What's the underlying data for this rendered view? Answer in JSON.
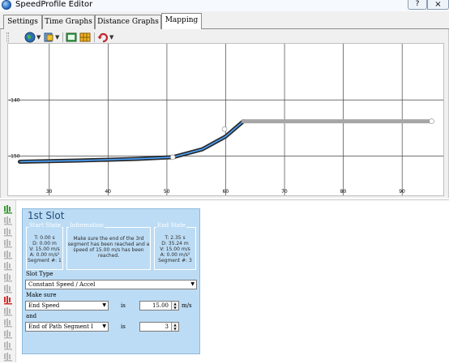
{
  "window": {
    "title": "SpeedProfile Editor",
    "help_label": "?",
    "close_label": "×"
  },
  "tabs": [
    {
      "label": "Settings"
    },
    {
      "label": "Time Graphs"
    },
    {
      "label": "Distance Graphs"
    },
    {
      "label": "Mapping"
    }
  ],
  "toolbar": {
    "icons": [
      "globe-icon",
      "layers-icon",
      "export-icon",
      "grid-icon",
      "undo-icon"
    ]
  },
  "chart_data": {
    "type": "line",
    "x_ticks": [
      "30",
      "40",
      "50",
      "60",
      "70",
      "80",
      "90"
    ],
    "y_ticks": [
      "-140",
      "-150"
    ],
    "xlim": [
      23,
      97
    ],
    "ylim": [
      -157,
      -130
    ],
    "series": [
      {
        "color": "#2a2a2a",
        "highlight": "#4aa3ff",
        "values": [
          [
            25,
            -151.0
          ],
          [
            35,
            -150.8
          ],
          [
            45,
            -150.5
          ],
          [
            51,
            -150.2
          ],
          [
            56,
            -148.8
          ],
          [
            60,
            -146.5
          ],
          [
            63,
            -143.8
          ]
        ]
      },
      {
        "color": "#a6a6a6",
        "values": [
          [
            63,
            -143.8
          ],
          [
            75,
            -143.8
          ],
          [
            85,
            -143.8
          ],
          [
            95,
            -143.8
          ]
        ]
      }
    ],
    "markers": [
      [
        51,
        -150.2
      ],
      [
        59.8,
        -145.2
      ],
      [
        95,
        -143.8
      ]
    ],
    "grid": true
  },
  "slots_strip": {
    "icons": [
      "slot-icon",
      "slot-icon",
      "slot-icon",
      "slot-icon",
      "slot-icon",
      "slot-icon",
      "slot-icon",
      "slot-icon",
      "slot-delete-icon",
      "slot-icon",
      "slot-icon",
      "slot-icon",
      "slot-icon",
      "slot-icon"
    ]
  },
  "slot": {
    "title": "1st Slot",
    "start": {
      "legend": "Start State",
      "lines": [
        "T: 0.00 s",
        "D: 0.00 m",
        "V: 15.00 m/s",
        "A: 0.00 m/s²",
        "Segment #: 1"
      ]
    },
    "info": {
      "legend": "Information",
      "lines": [
        "Make sure the end of the 3rd",
        "segment has been reached and a",
        "speed of 15.00 m/s has been",
        "reached."
      ]
    },
    "end": {
      "legend": "End State",
      "lines": [
        "T: 2.35 s",
        "D: 35.24 m",
        "V: 15.00 m/s",
        "A: 0.00 m/s²",
        "Segment #: 3"
      ]
    },
    "slot_type_label": "Slot Type",
    "slot_type_value": "Constant Speed / Accel",
    "make_sure_label": "Make sure",
    "cond1_field": "End Speed",
    "cond1_is": "is",
    "cond1_value": "15.00",
    "cond1_unit": "m/s",
    "and_label": "and",
    "cond2_field": "End of Path Segment I",
    "cond2_is": "is",
    "cond2_value": "3"
  }
}
